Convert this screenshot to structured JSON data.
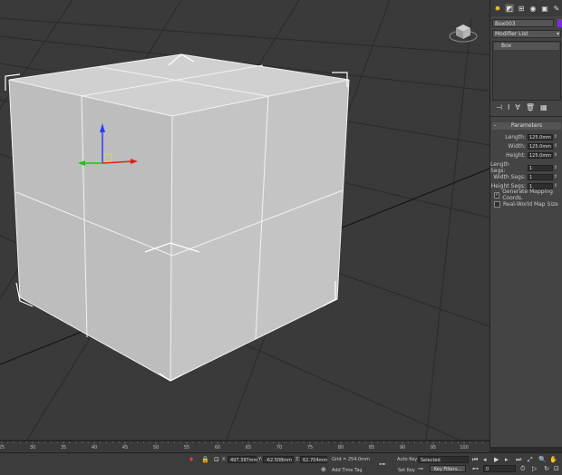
{
  "panel": {
    "object_name": "Box003",
    "modifier_list": "Modifier List",
    "stack_item": "Box",
    "rollout_title": "Parameters",
    "params": [
      {
        "label": "Length:",
        "value": "125.0mm"
      },
      {
        "label": "Width:",
        "value": "125.0mm"
      },
      {
        "label": "Height:",
        "value": "125.0mm"
      }
    ],
    "segs": [
      {
        "label": "Length Segs:",
        "value": "1"
      },
      {
        "label": "Width Segs:",
        "value": "1"
      },
      {
        "label": "Height Segs:",
        "value": "1"
      }
    ],
    "gen_mapping": "Generate Mapping Coords.",
    "real_world": "Real-World Map Size"
  },
  "timeline": {
    "ticks": [
      "25",
      "30",
      "35",
      "40",
      "45",
      "50",
      "55",
      "60",
      "65",
      "70",
      "75",
      "80",
      "85",
      "90",
      "95",
      "100"
    ]
  },
  "status": {
    "x_label": "X:",
    "x_value": "497.397mm",
    "y_label": "Y:",
    "y_value": "-62.508mm",
    "z_label": "Z:",
    "z_value": "62.704mm",
    "grid": "Grid = 254.0mm",
    "add_time_tag": "Add Time Tag",
    "auto_key": "Auto Key",
    "set_key": "Set Key",
    "selected": "Selected",
    "key_filters": "Key Filters...",
    "frame": "0"
  }
}
